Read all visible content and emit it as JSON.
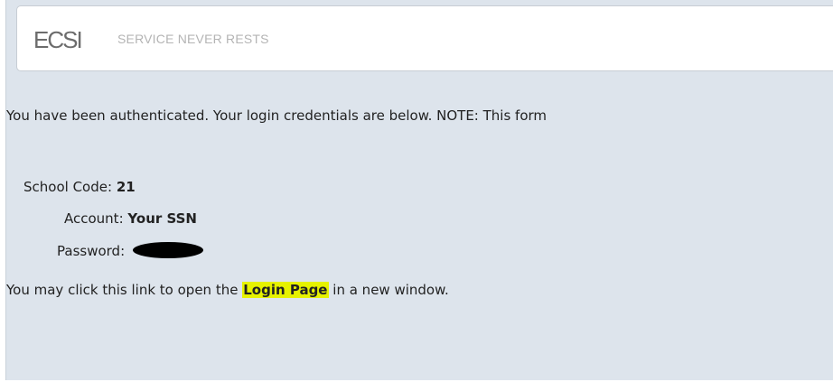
{
  "header": {
    "logo": "ECSI",
    "tagline": "SERVICE NEVER RESTS"
  },
  "message": "You have been authenticated. Your login credentials are below. NOTE: This form",
  "credentials": {
    "school_code_label": "School Code:",
    "school_code": "21",
    "account_label": "Account:",
    "account": "Your SSN",
    "password_label": "Password:"
  },
  "link_line": {
    "before": "You may click this link to open the",
    "link": "Login Page",
    "after": "in a new window."
  }
}
